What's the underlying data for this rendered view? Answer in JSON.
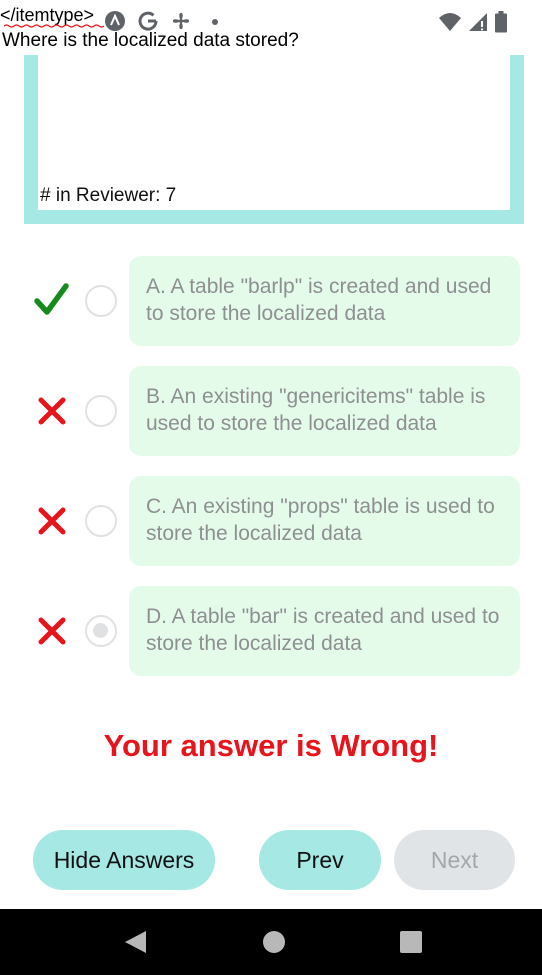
{
  "status_bar": {
    "code_text": "</itemtype>",
    "icons": [
      "app-icon",
      "google-icon",
      "settings-fan-icon",
      "dot-icon",
      "wifi-icon",
      "signal-icon",
      "battery-icon"
    ]
  },
  "question": "Where is the localized data stored?",
  "reviewer_text": "# in Reviewer: 7",
  "answers": [
    {
      "text": "A. A table \"barlp\" is created and used to store the localized data",
      "mark": "check-icon",
      "selected": false
    },
    {
      "text": "B. An existing \"genericitems\" table is used to store the localized data",
      "mark": "cross-icon",
      "selected": false
    },
    {
      "text": "C. An existing \"props\" table is used to store the localized data",
      "mark": "cross-icon",
      "selected": false
    },
    {
      "text": "D. A table \"bar\" is created and used to store the localized data",
      "mark": "cross-icon",
      "selected": true
    }
  ],
  "result_text": "Your answer is Wrong!",
  "buttons": {
    "hide_answers": "Hide Answers",
    "prev": "Prev",
    "next": "Next"
  },
  "colors": {
    "accent_teal": "#a5e8e4",
    "answer_bg": "#e5fbea",
    "correct_green": "#168a1d",
    "wrong_red": "#e8141b",
    "disabled_gray": "#e1e4e7"
  }
}
